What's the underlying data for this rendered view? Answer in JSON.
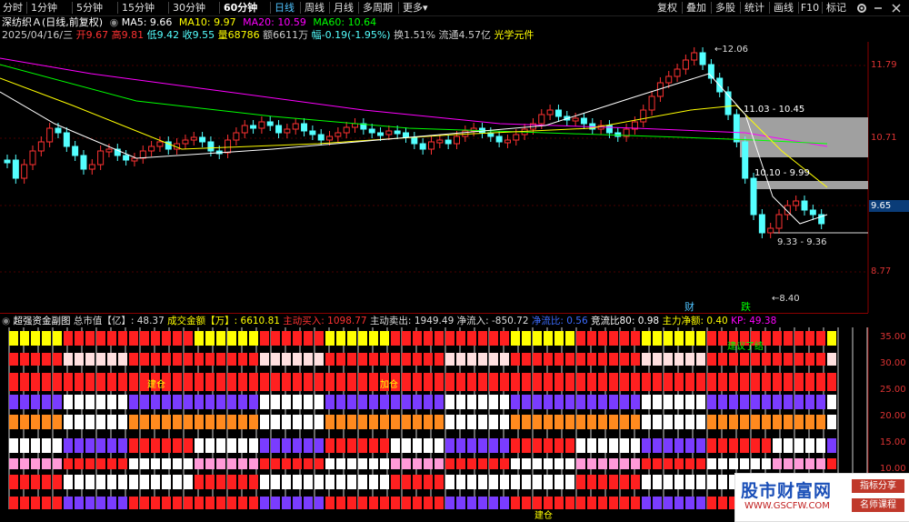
{
  "toolbar": {
    "periods": [
      "分时",
      "1分钟",
      "5分钟",
      "15分钟",
      "30分钟",
      "60分钟",
      "日线",
      "周线",
      "月线",
      "多周期",
      "更多"
    ],
    "active_period": "日线",
    "more_arrow": "▾",
    "right_buttons": [
      "复权",
      "叠加",
      "多股",
      "统计",
      "画线",
      "F10",
      "标记"
    ],
    "gear_icon": "gear-icon",
    "minus_icon": "minus-icon",
    "close_icon": "close-icon"
  },
  "stock": {
    "name_line": "深纺织Ａ(日线,前复权)",
    "ma5": "MA5: 9.66",
    "ma10": "MA10: 9.97",
    "ma20": "MA20: 10.59",
    "ma60": "MA60: 10.64",
    "date": "2025/04/16/三",
    "open": "开9.67",
    "high": "高9.81",
    "low": "低9.42",
    "close": "收9.55",
    "volume": "量68786",
    "amount": "额6611万",
    "change": "幅-0.19(-1.95%)",
    "turnover": "换1.51%",
    "float": "流通4.57亿",
    "concept": "光学元件"
  },
  "price_axis": [
    "11.79",
    "10.71",
    "9.65",
    "8.77"
  ],
  "current_price": "9.65",
  "annotations": {
    "high": "12.06",
    "low": "8.40",
    "gap1": "11.03 - 10.45",
    "gap2": "10.10 - 9.99",
    "gap3": "9.33 - 9.36",
    "cai": "财",
    "die": "跌"
  },
  "sub": {
    "title": "超强资金副图",
    "mktcap_label": "总市值【亿】: ",
    "mktcap": "48.37",
    "amount_label": "成交金额【万】: ",
    "amount": "6610.81",
    "buy_label": "主动买入: ",
    "buy": "1098.77",
    "sell_label": "主动卖出: ",
    "sell": "1949.49",
    "net_label": "净流入: ",
    "net": "-850.72",
    "ratio_label": "净流比: ",
    "ratio": "0.56",
    "comp_label": "竞流比80: ",
    "comp": "0.98",
    "main_label": "主力净额: ",
    "main": "0.40",
    "kp_label": "KP: ",
    "kp": "49.38",
    "axis": [
      "35.00",
      "30.00",
      "25.00",
      "20.00",
      "15.00",
      "10.00"
    ],
    "text_suggest": "建议了结",
    "text_build": "建仓",
    "text_add": "加仓",
    "text_jiancang": "建仓"
  },
  "colors": {
    "up": "#ff3232",
    "down": "#54ffff",
    "ma5": "#ffffff",
    "ma10": "#ffff00",
    "ma20": "#ff00ff",
    "ma60": "#00ff00"
  },
  "watermark": {
    "title": "股市财富网",
    "url": "WWW.GSCFW.COM",
    "tag1": "指标分享",
    "tag2": "名师课程"
  }
}
